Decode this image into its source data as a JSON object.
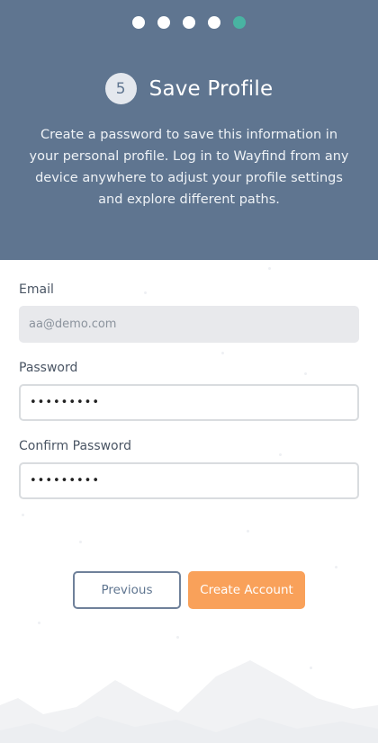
{
  "progress": {
    "total_steps": 5,
    "current_step": 5
  },
  "step": {
    "number": "5",
    "title": "Save Profile",
    "description": "Create a password to save this information in your personal profile. Log in to Wayfind from any device anywhere to adjust your profile settings and explore different paths."
  },
  "form": {
    "email_label": "Email",
    "email_value": "aa@demo.com",
    "password_label": "Password",
    "password_value": "passwords",
    "confirm_label": "Confirm Password",
    "confirm_value": "passwords"
  },
  "buttons": {
    "previous": "Previous",
    "create": "Create Account"
  },
  "colors": {
    "header_bg": "#5f7590",
    "active_dot": "#49b3a2",
    "primary_button": "#f9a15a"
  }
}
